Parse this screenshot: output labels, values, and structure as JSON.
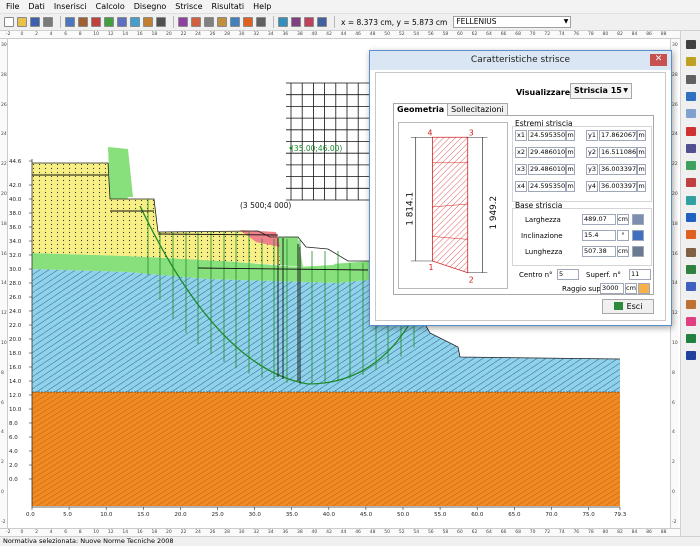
{
  "menu": [
    "File",
    "Dati",
    "Inserisci",
    "Calcolo",
    "Disegno",
    "Strisce",
    "Risultati",
    "Help"
  ],
  "toolbar": {
    "coordinates": "x = 8.373 cm, y = 5.873 cm",
    "method": "FELLENIUS"
  },
  "icons": {
    "toolbar": [
      "new-file-icon",
      "open-folder-icon",
      "save-icon",
      "undo-icon",
      "report-icon",
      "surface-icon",
      "strip-icon",
      "stats-icon",
      "layers-icon",
      "water-icon",
      "chart-icon",
      "grid-icon",
      "calc-icon",
      "calc-icon-2",
      "wall-icon",
      "anchor-icon",
      "load-icon",
      "palette-icon",
      "print-icon",
      "ruler-icon",
      "zoom-icon",
      "color-icon",
      "help-icon"
    ],
    "palette": [
      "pan-icon",
      "select-icon",
      "grid-icon",
      "line-icon",
      "layer-icon",
      "line-red-icon",
      "polyline-icon",
      "polygon-icon",
      "surface-icon",
      "strip-icon",
      "water-icon",
      "load-icon",
      "anchor-icon",
      "text-icon",
      "dim-icon",
      "soil-icon",
      "color-icon",
      "tree-icon",
      "histogram-icon"
    ]
  },
  "rulers": {
    "top": [
      "-2",
      "0",
      "2",
      "4",
      "6",
      "8",
      "10",
      "12",
      "14",
      "16",
      "18",
      "20",
      "22",
      "24",
      "26",
      "28",
      "30",
      "32",
      "34",
      "36",
      "38",
      "40",
      "42",
      "44",
      "46",
      "48",
      "50",
      "52",
      "54",
      "56",
      "58",
      "60",
      "62",
      "64",
      "66",
      "68",
      "70",
      "72",
      "74",
      "76",
      "78",
      "80",
      "82",
      "84",
      "86",
      "88"
    ],
    "left": [
      "30",
      "28",
      "26",
      "24",
      "22",
      "20",
      "18",
      "16",
      "14",
      "12",
      "10",
      "8",
      "6",
      "4",
      "2",
      "0",
      "-2"
    ]
  },
  "drawing": {
    "y_labels": [
      "44.6",
      "42.0",
      "40.0",
      "38.0",
      "36.0",
      "34.0",
      "32.0",
      "30.0",
      "28.0",
      "26.0",
      "24.0",
      "22.0",
      "20.0",
      "18.0",
      "16.0",
      "14.0",
      "12.0",
      "10.0",
      "8.0",
      "6.0",
      "4.0",
      "2.0",
      "0.0"
    ],
    "x_labels": [
      "0.0",
      "5.0",
      "10.0",
      "15.0",
      "20.0",
      "25.0",
      "30.0",
      "35.0",
      "40.0",
      "45.0",
      "50.0",
      "55.0",
      "60.0",
      "65.0",
      "70.0",
      "75.0",
      "79.3"
    ],
    "grid_center_label": "(35.00;46.00)",
    "grid_point_label": "(3 500;4 000)"
  },
  "colors": {
    "soil_yellow": "#f7ef84",
    "soil_green": "#88e07c",
    "soil_blue": "#8fd3ea",
    "soil_orange": "#f08a22",
    "soil_red": "#f0808a",
    "surface_line": "#1e8a2a",
    "dialog_border": "#5b8ec8",
    "close_button": "#c75050"
  },
  "dialog": {
    "title": "Caratteristiche strisce",
    "close": "✕",
    "visualize_label": "Visualizzare:",
    "strip_selected": "Striscia 15",
    "tabs": [
      "Geometria",
      "Sollecitazioni"
    ],
    "preview": {
      "corners": [
        "4",
        "3",
        "1",
        "2"
      ],
      "left_dim": "1 814.1",
      "right_dim": "1 949.2"
    },
    "extremes": {
      "title": "Estremi striscia",
      "rows": [
        {
          "xl": "x1",
          "xv": "24.595350",
          "xu": "m",
          "yl": "y1",
          "yv": "17.862067",
          "yu": "m"
        },
        {
          "xl": "x2",
          "xv": "29.486010",
          "xu": "m",
          "yl": "y2",
          "yv": "16.511086",
          "yu": "m"
        },
        {
          "xl": "x3",
          "xv": "29.486010",
          "xu": "m",
          "yl": "y3",
          "yv": "36.003397",
          "yu": "m"
        },
        {
          "xl": "x4",
          "xv": "24.595350",
          "xu": "m",
          "yl": "y4",
          "yv": "36.003397",
          "yu": "m"
        }
      ]
    },
    "base": {
      "title": "Base striscia",
      "rows": [
        {
          "label": "Larghezza",
          "value": "489.07",
          "unit": "cm"
        },
        {
          "label": "Inclinazione",
          "value": "15.4",
          "unit": "°"
        },
        {
          "label": "Lunghezza",
          "value": "507.38",
          "unit": "cm"
        }
      ]
    },
    "center_label": "Centro n°",
    "center_value": "5",
    "surface_label": "Superf. n°",
    "surface_value": "11",
    "radius_label": "Raggio sup.",
    "radius_value": "3000",
    "radius_unit": "cm",
    "exit_label": "Esci"
  },
  "status": "Normativa selezionata: Nuove Norme Tecniche 2008"
}
